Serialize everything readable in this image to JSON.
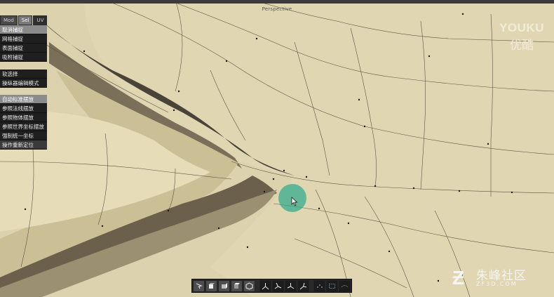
{
  "viewport": {
    "label": "Perspective"
  },
  "tabs": [
    {
      "label": "Mod",
      "active": false
    },
    {
      "label": "Sel",
      "active": true
    },
    {
      "label": "UV",
      "active": false
    }
  ],
  "menu_group1": [
    {
      "label": "取消捕捉",
      "style": "light"
    },
    {
      "label": "网格捕捉",
      "style": "dark"
    },
    {
      "label": "表面捕捉",
      "style": "dark"
    },
    {
      "label": "吸附捕捉",
      "style": "dark"
    }
  ],
  "menu_group2": [
    {
      "label": "软选择",
      "style": "dark"
    },
    {
      "label": "操纵器编辑模式",
      "style": "dark"
    }
  ],
  "menu_group3": [
    {
      "label": "自动标准摆放",
      "style": "light"
    },
    {
      "label": "参照法线摆放",
      "style": "dark"
    },
    {
      "label": "参照物体摆放",
      "style": "dark"
    },
    {
      "label": "参照世界坐标摆放",
      "style": "dark"
    },
    {
      "label": "强制统一坐标",
      "style": "dark"
    },
    {
      "label": "操作重新定位",
      "style": "mid"
    }
  ],
  "toolbar": {
    "group1": [
      "select-tool-icon",
      "cube-front-icon",
      "cube-side-icon",
      "cube-top-icon",
      "cube-wire-icon"
    ],
    "group2": [
      "axis-x-icon",
      "axis-y-icon",
      "axis-z-icon",
      "axis-world-icon"
    ],
    "group3": [
      "vertex-mode-icon",
      "edge-mode-icon",
      "face-mode-icon"
    ]
  },
  "watermarks": {
    "top_line1": "YOUKU",
    "top_line2": "优酷",
    "bottom_cn": "朱峰社区",
    "bottom_en": "ZF3D.COM"
  },
  "colors": {
    "surface": "#d9cfa9",
    "panel_dark": "#1f1f1f",
    "panel_light": "#8b8b8b",
    "cursor": "#28aa8c"
  }
}
